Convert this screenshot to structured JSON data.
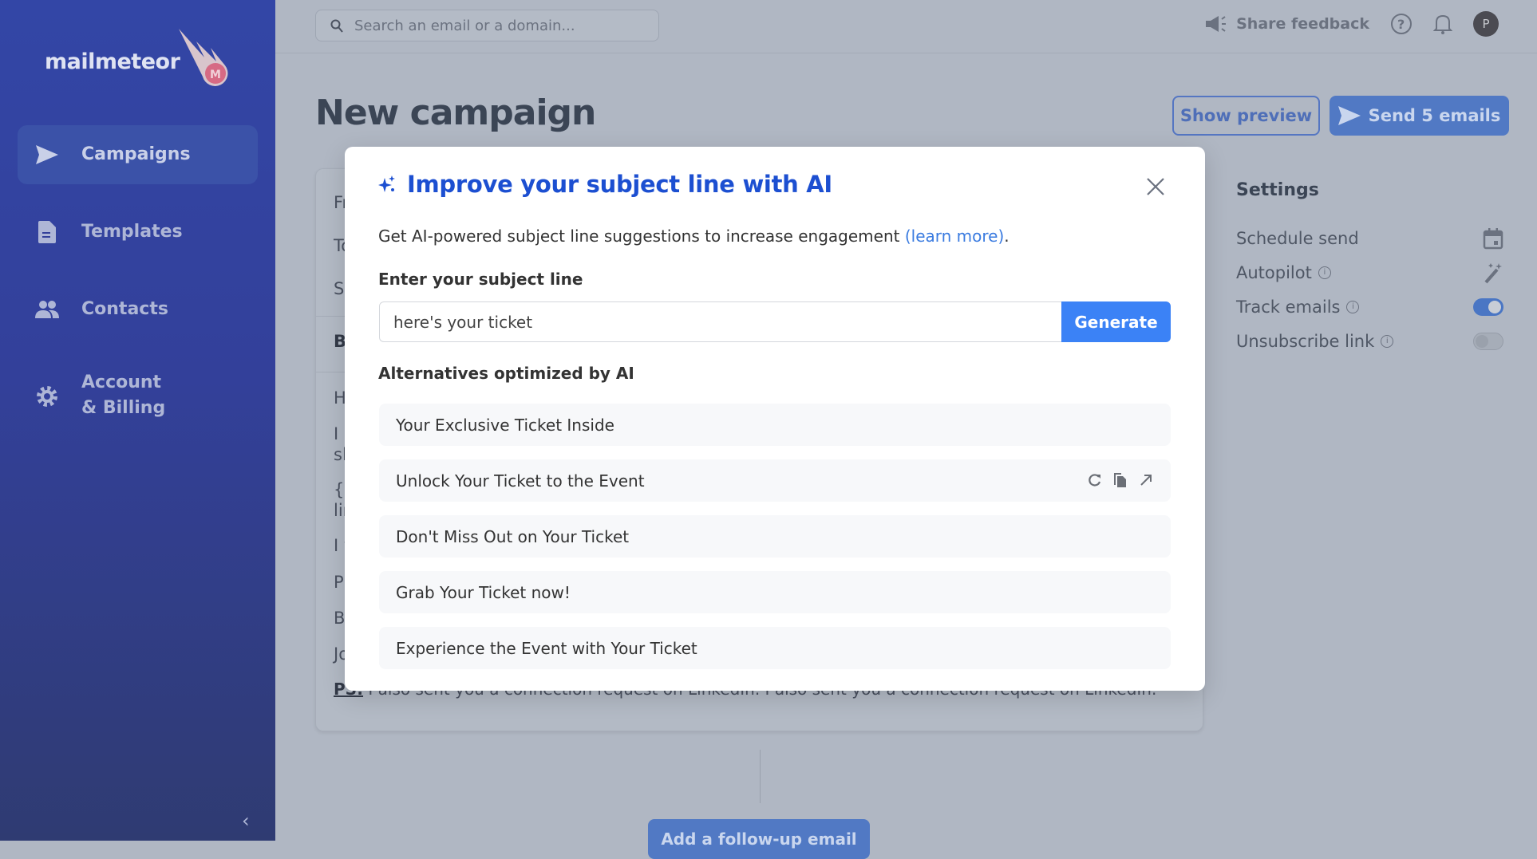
{
  "sidebar": {
    "logo_text": "mailmeteor",
    "items": [
      {
        "label": "Campaigns",
        "icon": "send-icon",
        "active": true
      },
      {
        "label": "Templates",
        "icon": "document-icon"
      },
      {
        "label": "Contacts",
        "icon": "people-icon"
      },
      {
        "label_line1": "Account",
        "label_line2": "& Billing",
        "icon": "gear-icon"
      }
    ]
  },
  "header": {
    "search_placeholder": "Search an email or a domain...",
    "share_feedback": "Share feedback",
    "avatar_initial": "P"
  },
  "page": {
    "title": "New campaign",
    "show_preview": "Show preview",
    "send_button": "Send 5 emails",
    "add_followup": "Add a follow-up email"
  },
  "editor": {
    "field_fragments": [
      "Fr",
      "To",
      "Su"
    ],
    "body_bold": "B",
    "body_fragments": [
      "H",
      "I r",
      "sl",
      "{{",
      "lir",
      "I v",
      "P",
      "B",
      "Jo"
    ],
    "ps_label": "PS:",
    "ps_text": " I also sent you a connection request on LinkedIn. I also sent you a connection request on LinkedIn."
  },
  "settings": {
    "title": "Settings",
    "rows": [
      {
        "label": "Schedule send",
        "control": "calendar-icon"
      },
      {
        "label": "Autopilot",
        "control": "magic-wand-icon"
      },
      {
        "label": "Track emails",
        "control": "toggle",
        "on": true
      },
      {
        "label": "Unsubscribe link",
        "control": "toggle",
        "on": false
      }
    ]
  },
  "modal": {
    "title": "Improve your subject line with AI",
    "description": "Get AI-powered subject line suggestions to increase engagement ",
    "learn_more": "(learn more)",
    "description_end": ".",
    "input_label": "Enter your subject line",
    "input_value": "here's your ticket",
    "generate": "Generate",
    "alternatives_label": "Alternatives optimized by AI",
    "alternatives": [
      "Your Exclusive Ticket Inside",
      "Unlock Your Ticket to the Event",
      "Don't Miss Out on Your Ticket",
      "Grab Your Ticket now!",
      "Experience the Event with Your Ticket"
    ]
  },
  "colors": {
    "accent": "#3b82f6",
    "title_blue": "#1c4fd1",
    "sidebar": "#3346a6"
  }
}
